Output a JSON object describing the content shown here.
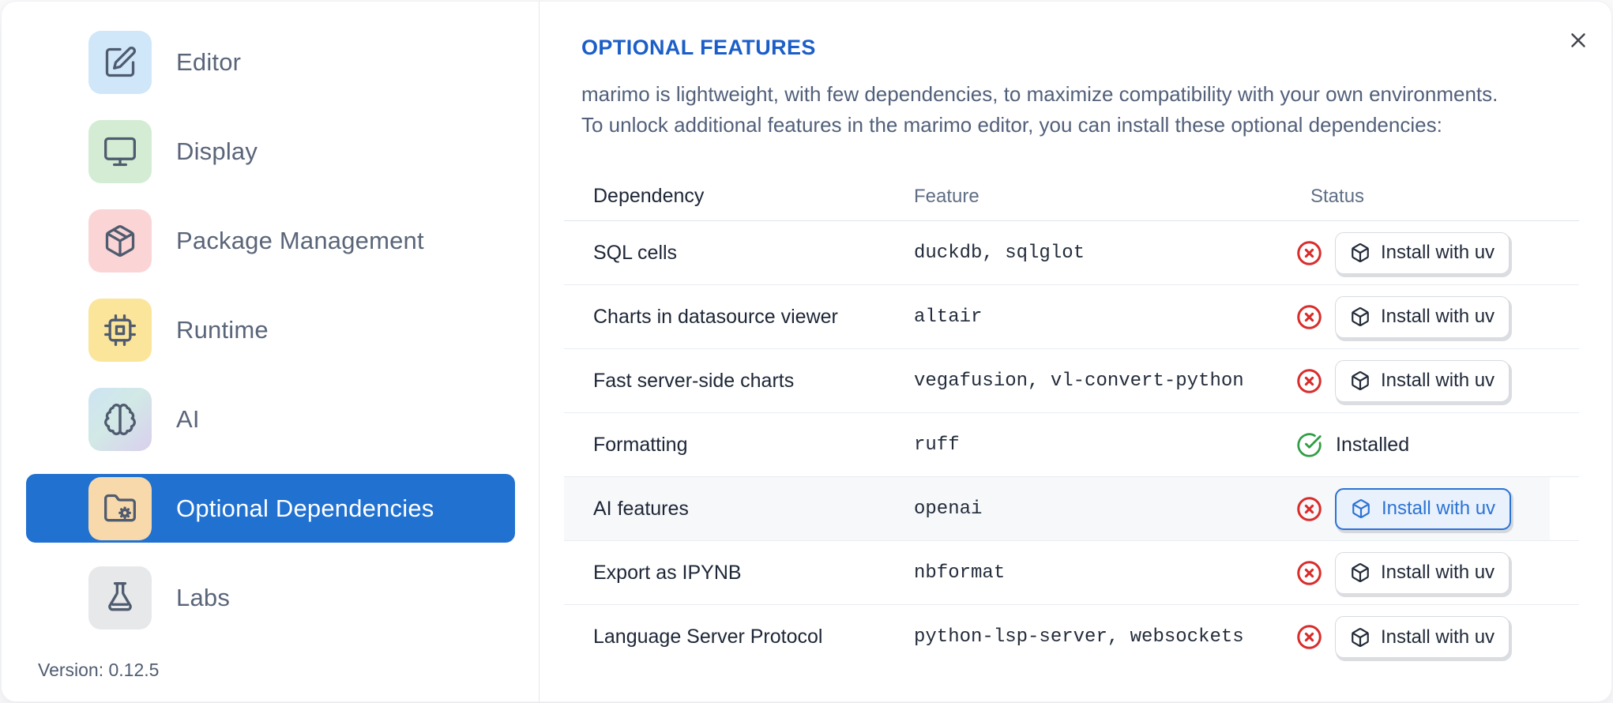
{
  "sidebar": {
    "items": [
      {
        "label": "Editor",
        "icon": "square-pen-icon",
        "tile_color": "#cfe7f9",
        "selected": false
      },
      {
        "label": "Display",
        "icon": "monitor-icon",
        "tile_color": "#d4ecd4",
        "selected": false
      },
      {
        "label": "Package Management",
        "icon": "package-icon",
        "tile_color": "#fbd5d5",
        "selected": false
      },
      {
        "label": "Runtime",
        "icon": "cpu-icon",
        "tile_color": "#fbe59b",
        "selected": false
      },
      {
        "label": "AI",
        "icon": "brain-icon",
        "tile_color": "linear-gradient(135deg,#cde4f3 0%,#d2e9e6 45%,#d9cfee 100%)",
        "selected": false
      },
      {
        "label": "Optional Dependencies",
        "icon": "folder-cog-icon",
        "tile_color": "#f8d9ab",
        "selected": true
      },
      {
        "label": "Labs",
        "icon": "flask-icon",
        "tile_color": "#e6e8ea",
        "selected": false
      }
    ],
    "version": "Version: 0.12.5"
  },
  "panel": {
    "title": "OPTIONAL FEATURES",
    "description": "marimo is lightweight, with few dependencies, to maximize compatibility with your own environments.\nTo unlock additional features in the marimo editor, you can install these optional dependencies:",
    "close_icon": "close-icon"
  },
  "table": {
    "columns": [
      "Dependency",
      "Feature",
      "Status"
    ],
    "install_button_icon": "box-icon",
    "rows": [
      {
        "dependency": "SQL cells",
        "feature": "duckdb, sqlglot",
        "status": "missing",
        "action_label": "Install with uv",
        "highlighted": false,
        "button_focused": false
      },
      {
        "dependency": "Charts in datasource viewer",
        "feature": "altair",
        "status": "missing",
        "action_label": "Install with uv",
        "highlighted": false,
        "button_focused": false
      },
      {
        "dependency": "Fast server-side charts",
        "feature": "vegafusion, vl-convert-python",
        "status": "missing",
        "action_label": "Install with uv",
        "highlighted": false,
        "button_focused": false
      },
      {
        "dependency": "Formatting",
        "feature": "ruff",
        "status": "installed",
        "status_label": "Installed",
        "highlighted": false,
        "button_focused": false
      },
      {
        "dependency": "AI features",
        "feature": "openai",
        "status": "missing",
        "action_label": "Install with uv",
        "highlighted": true,
        "button_focused": true
      },
      {
        "dependency": "Export as IPYNB",
        "feature": "nbformat",
        "status": "missing",
        "action_label": "Install with uv",
        "highlighted": false,
        "button_focused": false
      },
      {
        "dependency": "Language Server Protocol",
        "feature": "python-lsp-server, websockets",
        "status": "missing",
        "action_label": "Install with uv",
        "highlighted": false,
        "button_focused": false
      }
    ]
  },
  "colors": {
    "accent_blue": "#2171d0",
    "title_blue": "#1b5ec9",
    "status_red": "#d92c2c",
    "status_green": "#2f9e44",
    "text_dark": "#1d2636",
    "text_muted": "#5f6e85",
    "border": "#e8ecf2"
  }
}
